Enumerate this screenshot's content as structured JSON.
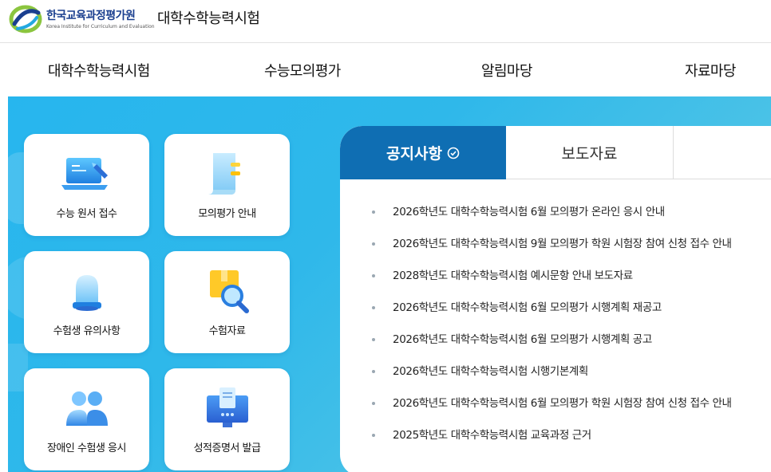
{
  "header": {
    "org_name": "한국교육과정평가원",
    "org_sub": "Korea Institute for Curriculum and Evaluation",
    "site_title": "대학수학능력시험",
    "logo_icon": "kice-logo"
  },
  "gnb": [
    {
      "label": "대학수학능력시험"
    },
    {
      "label": "수능모의평가"
    },
    {
      "label": "알림마당"
    },
    {
      "label": "자료마당"
    }
  ],
  "quick_menu": [
    {
      "label": "수능 원서 접수",
      "icon": "laptop-icon"
    },
    {
      "label": "모의평가 안내",
      "icon": "document-icon"
    },
    {
      "label": "수험생 유의사항",
      "icon": "alarm-light-icon"
    },
    {
      "label": "수험자료",
      "icon": "box-search-icon"
    },
    {
      "label": "장애인 수험생 응시",
      "icon": "people-icon"
    },
    {
      "label": "성적증명서 발급",
      "icon": "certificate-monitor-icon"
    }
  ],
  "board": {
    "tabs": [
      {
        "label": "공지사항",
        "active": true
      },
      {
        "label": "보도자료",
        "active": false
      }
    ],
    "notices": [
      {
        "title": "2026학년도 대학수학능력시험 6월 모의평가 온라인 응시 안내"
      },
      {
        "title": "2026학년도 대학수학능력시험 9월 모의평가 학원 시험장 참여 신청 접수 안내"
      },
      {
        "title": "2028학년도 대학수학능력시험 예시문항 안내 보도자료"
      },
      {
        "title": "2026학년도 대학수학능력시험 6월 모의평가 시행계획 재공고"
      },
      {
        "title": "2026학년도 대학수학능력시험 6월 모의평가 시행계획 공고"
      },
      {
        "title": "2026학년도 대학수학능력시험 시행기본계획"
      },
      {
        "title": "2026학년도 대학수학능력시험 6월 모의평가 학원 시험장 참여 신청 접수 안내"
      },
      {
        "title": "2025학년도 대학수학능력시험 교육과정 근거"
      }
    ]
  },
  "colors": {
    "brand_blue": "#0f6eb3",
    "hero_bg": "#2fb8ea",
    "logo_green": "#8bc53f",
    "logo_navy": "#1a3f8f"
  }
}
